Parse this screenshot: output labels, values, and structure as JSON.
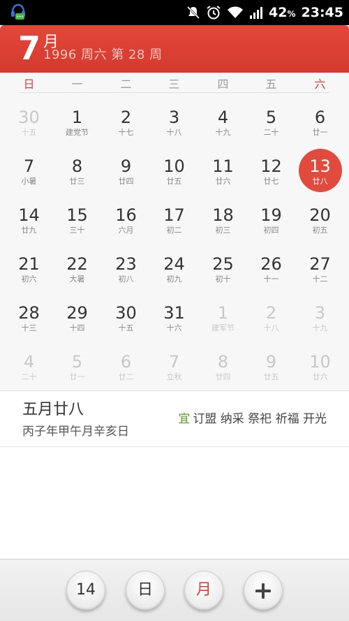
{
  "status_bar": {
    "battery": "42",
    "battery_unit": "%",
    "time": "23:45",
    "icons": [
      "notification-app-icon",
      "mute-icon",
      "alarm-icon",
      "wifi-icon",
      "signal-icon"
    ]
  },
  "header": {
    "month_number": "7",
    "month_suffix": "月",
    "subtitle": "1996  周六  第 28 周"
  },
  "weekdays": [
    "日",
    "一",
    "二",
    "三",
    "四",
    "五",
    "六"
  ],
  "calendar": {
    "weeks": [
      [
        {
          "d": "30",
          "l": "十五",
          "other": true
        },
        {
          "d": "1",
          "l": "建党节"
        },
        {
          "d": "2",
          "l": "十七"
        },
        {
          "d": "3",
          "l": "十八"
        },
        {
          "d": "4",
          "l": "十九"
        },
        {
          "d": "5",
          "l": "二十"
        },
        {
          "d": "6",
          "l": "廿一"
        }
      ],
      [
        {
          "d": "7",
          "l": "小暑"
        },
        {
          "d": "8",
          "l": "廿三"
        },
        {
          "d": "9",
          "l": "廿四"
        },
        {
          "d": "10",
          "l": "廿五"
        },
        {
          "d": "11",
          "l": "廿六"
        },
        {
          "d": "12",
          "l": "廿七"
        },
        {
          "d": "13",
          "l": "廿八",
          "selected": true
        }
      ],
      [
        {
          "d": "14",
          "l": "廿九"
        },
        {
          "d": "15",
          "l": "三十"
        },
        {
          "d": "16",
          "l": "六月"
        },
        {
          "d": "17",
          "l": "初二"
        },
        {
          "d": "18",
          "l": "初三"
        },
        {
          "d": "19",
          "l": "初四"
        },
        {
          "d": "20",
          "l": "初五"
        }
      ],
      [
        {
          "d": "21",
          "l": "初六"
        },
        {
          "d": "22",
          "l": "大暑"
        },
        {
          "d": "23",
          "l": "初八"
        },
        {
          "d": "24",
          "l": "初九"
        },
        {
          "d": "25",
          "l": "初十"
        },
        {
          "d": "26",
          "l": "十一"
        },
        {
          "d": "27",
          "l": "十二"
        }
      ],
      [
        {
          "d": "28",
          "l": "十三"
        },
        {
          "d": "29",
          "l": "十四"
        },
        {
          "d": "30",
          "l": "十五"
        },
        {
          "d": "31",
          "l": "十六"
        },
        {
          "d": "1",
          "l": "建军节",
          "other": true
        },
        {
          "d": "2",
          "l": "十八",
          "other": true
        },
        {
          "d": "3",
          "l": "十九",
          "other": true
        }
      ],
      [
        {
          "d": "4",
          "l": "二十",
          "other": true
        },
        {
          "d": "5",
          "l": "廿一",
          "other": true
        },
        {
          "d": "6",
          "l": "廿二",
          "other": true
        },
        {
          "d": "7",
          "l": "立秋",
          "other": true
        },
        {
          "d": "8",
          "l": "廿四",
          "other": true
        },
        {
          "d": "9",
          "l": "廿五",
          "other": true
        },
        {
          "d": "10",
          "l": "廿六",
          "other": true
        }
      ]
    ]
  },
  "day_info": {
    "lunar_date": "五月廿八",
    "ganzhi": "丙子年甲午月辛亥日",
    "yi_label": "宜",
    "yi_items": "订盟 纳采 祭祀 祈福 开光"
  },
  "toolbar": {
    "today_label": "14",
    "day_view_label": "日",
    "month_view_label": "月",
    "add_icon": "plus-icon"
  },
  "colors": {
    "accent": "#e14b3d",
    "header": "#dc4034",
    "yi_green": "#5a9a2a"
  }
}
